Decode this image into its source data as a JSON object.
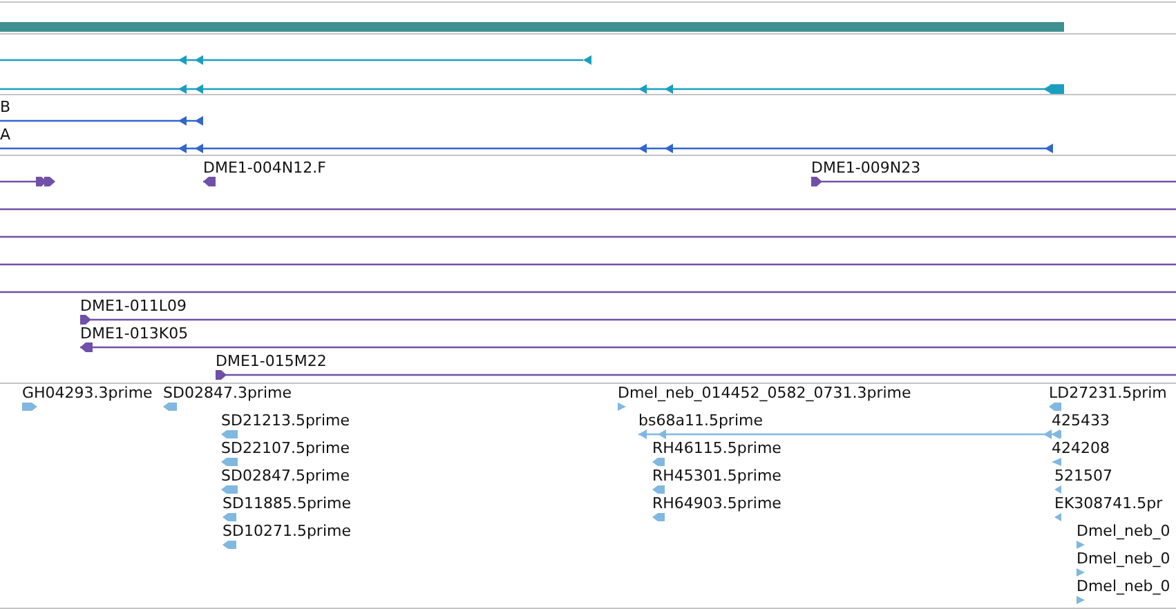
{
  "tracks": [
    {
      "kind": "gene_span",
      "features": [
        {
          "kind": "bar"
        }
      ]
    },
    {
      "kind": "transcripts",
      "features": [
        {
          "kind": "transcript",
          "reverse": true
        },
        {
          "kind": "transcript",
          "reverse": true
        }
      ]
    },
    {
      "kind": "transcripts_labelled",
      "features": [
        {
          "kind": "transcript",
          "label": "B",
          "reverse": true
        },
        {
          "kind": "transcript",
          "label": "A",
          "reverse": true
        }
      ]
    },
    {
      "kind": "clones",
      "features": [
        {
          "kind": "clone",
          "reverse": false
        },
        {
          "kind": "clone",
          "label": "DME1-004N12.F",
          "reverse": true
        },
        {
          "kind": "clone",
          "label": "DME1-009N23",
          "reverse": false
        },
        {
          "kind": "clone"
        },
        {
          "kind": "clone"
        },
        {
          "kind": "clone"
        },
        {
          "kind": "clone"
        },
        {
          "kind": "clone",
          "label": "DME1-011L09",
          "reverse": false
        },
        {
          "kind": "clone",
          "label": "DME1-013K05",
          "reverse": true
        },
        {
          "kind": "clone",
          "label": "DME1-015M22",
          "reverse": false
        }
      ]
    },
    {
      "kind": "ests",
      "features": [
        {
          "kind": "est",
          "label": "GH04293.3prime",
          "reverse": false
        },
        {
          "kind": "est",
          "label": "SD02847.3prime",
          "reverse": true
        },
        {
          "kind": "est",
          "label": "SD21213.5prime",
          "reverse": true
        },
        {
          "kind": "est",
          "label": "SD22107.5prime",
          "reverse": true
        },
        {
          "kind": "est",
          "label": "SD02847.5prime",
          "reverse": true
        },
        {
          "kind": "est",
          "label": "SD11885.5prime",
          "reverse": true
        },
        {
          "kind": "est",
          "label": "SD10271.5prime",
          "reverse": true
        },
        {
          "kind": "est",
          "label": "Dmel_neb_014452_0582_0731.3prime",
          "reverse": false
        },
        {
          "kind": "est",
          "label": "bs68a11.5prime",
          "reverse": true
        },
        {
          "kind": "est",
          "label": "RH46115.5prime",
          "reverse": true
        },
        {
          "kind": "est",
          "label": "RH45301.5prime",
          "reverse": true
        },
        {
          "kind": "est",
          "label": "RH64903.5prime",
          "reverse": true
        },
        {
          "kind": "est",
          "label": "LD27231.5prim",
          "reverse": true
        },
        {
          "kind": "est",
          "label": "425433",
          "reverse": true
        },
        {
          "kind": "est",
          "label": "424208",
          "reverse": true
        },
        {
          "kind": "est",
          "label": "521507",
          "reverse": true
        },
        {
          "kind": "est",
          "label": "EK308741.5pr",
          "reverse": true
        },
        {
          "kind": "est",
          "label": "Dmel_neb_0",
          "reverse": false
        },
        {
          "kind": "est",
          "label": "Dmel_neb_0",
          "reverse": false
        },
        {
          "kind": "est",
          "label": "Dmel_neb_0",
          "reverse": false
        }
      ]
    }
  ]
}
